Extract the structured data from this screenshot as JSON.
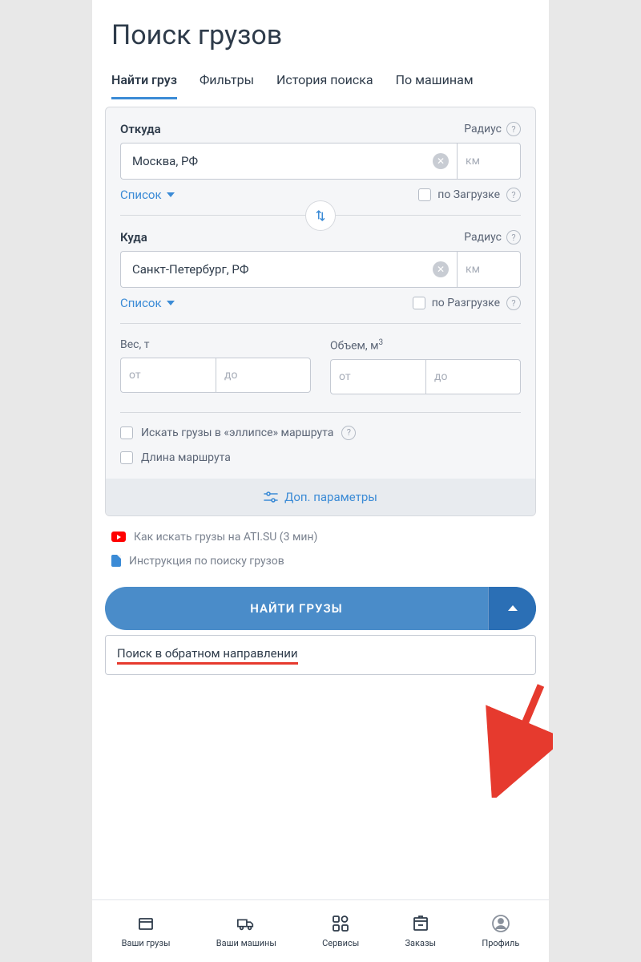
{
  "page_title": "Поиск грузов",
  "tabs": [
    "Найти груз",
    "Фильтры",
    "История поиска",
    "По машинам"
  ],
  "active_tab": 0,
  "from": {
    "label": "Откуда",
    "value": "Москва, РФ",
    "radius_label": "Радиус",
    "km_placeholder": "км",
    "list_link": "Список",
    "checkbox_label": "по Загрузке"
  },
  "to": {
    "label": "Куда",
    "value": "Санкт-Петербург, РФ",
    "radius_label": "Радиус",
    "km_placeholder": "км",
    "list_link": "Список",
    "checkbox_label": "по Разгрузке"
  },
  "weight": {
    "label": "Вес, т",
    "from_placeholder": "от",
    "to_placeholder": "до"
  },
  "volume": {
    "label_html": "Объем, м",
    "sup": "3",
    "from_placeholder": "от",
    "to_placeholder": "до"
  },
  "options": {
    "ellipse": "Искать грузы в «эллипсе» маршрута",
    "route_length": "Длина маршрута"
  },
  "more_params": "Доп. параметры",
  "help_links": {
    "video": "Как искать грузы на ATI.SU (3 мин)",
    "doc": "Инструкция по поиску грузов"
  },
  "search_button": "НАЙТИ ГРУЗЫ",
  "dropdown_option": "Поиск в обратном направлении",
  "bottom_nav": [
    "Ваши грузы",
    "Ваши машины",
    "Сервисы",
    "Заказы",
    "Профиль"
  ]
}
